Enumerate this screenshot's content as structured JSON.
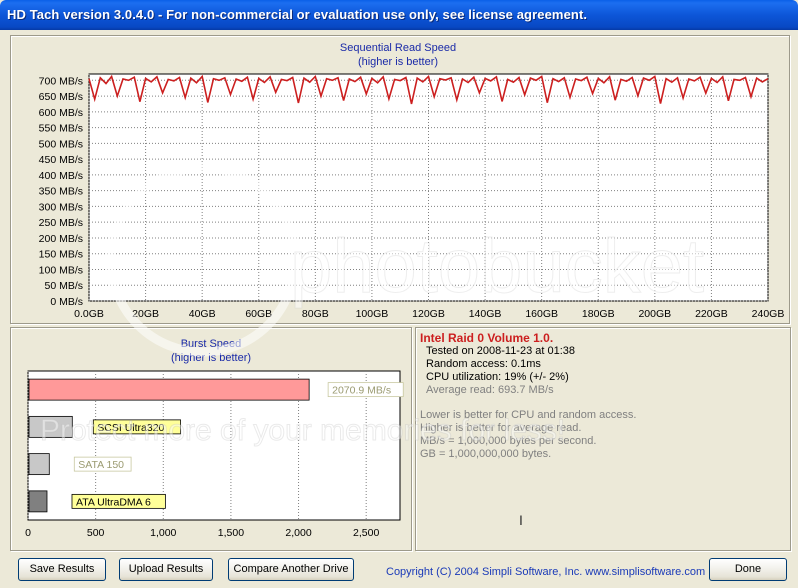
{
  "window": {
    "title": "HD Tach version 3.0.4.0  - For non-commercial or evaluation use only, see license agreement."
  },
  "chart_data": [
    {
      "type": "line",
      "title": "Sequential Read Speed",
      "subtitle": "(higher is better)",
      "x_ticks": [
        "0.0GB",
        "20GB",
        "40GB",
        "60GB",
        "80GB",
        "100GB",
        "120GB",
        "140GB",
        "160GB",
        "180GB",
        "200GB",
        "220GB",
        "240GB"
      ],
      "y_ticks": [
        "0 MB/s",
        "50 MB/s",
        "100 MB/s",
        "150 MB/s",
        "200 MB/s",
        "250 MB/s",
        "300 MB/s",
        "350 MB/s",
        "400 MB/s",
        "450 MB/s",
        "500 MB/s",
        "550 MB/s",
        "600 MB/s",
        "650 MB/s",
        "700 MB/s"
      ],
      "xlim": [
        0,
        240
      ],
      "ylim": [
        0,
        720
      ],
      "x_unit": "GB",
      "y_unit": "MB/s",
      "grid": true,
      "series": [
        {
          "color": "#cc1f1f",
          "x": [
            0,
            2,
            4,
            6,
            8,
            10,
            12,
            14,
            16,
            18,
            20,
            22,
            24,
            26,
            28,
            30,
            32,
            34,
            36,
            38,
            40,
            42,
            44,
            46,
            48,
            50,
            52,
            54,
            56,
            58,
            60,
            62,
            64,
            66,
            68,
            70,
            72,
            74,
            76,
            78,
            80,
            82,
            84,
            86,
            88,
            90,
            92,
            94,
            96,
            98,
            100,
            102,
            104,
            106,
            108,
            110,
            112,
            114,
            116,
            118,
            120,
            122,
            124,
            126,
            128,
            130,
            132,
            134,
            136,
            138,
            140,
            142,
            144,
            146,
            148,
            150,
            152,
            154,
            156,
            158,
            160,
            162,
            164,
            166,
            168,
            170,
            172,
            174,
            176,
            178,
            180,
            182,
            184,
            186,
            188,
            190,
            192,
            194,
            196,
            198,
            200,
            202,
            204,
            206,
            208,
            210,
            212,
            214,
            216,
            218,
            220,
            222,
            224,
            226,
            228,
            230,
            232,
            234,
            236,
            238,
            240
          ],
          "values": [
            705,
            640,
            708,
            690,
            712,
            650,
            704,
            700,
            710,
            632,
            706,
            695,
            711,
            660,
            703,
            698,
            709,
            645,
            707,
            692,
            712,
            630,
            705,
            700,
            708,
            655,
            704,
            697,
            710,
            640,
            706,
            693,
            711,
            662,
            703,
            699,
            709,
            628,
            707,
            694,
            712,
            650,
            705,
            700,
            708,
            636,
            704,
            696,
            710,
            657,
            706,
            692,
            711,
            641,
            703,
            699,
            709,
            625,
            707,
            695,
            712,
            648,
            705,
            701,
            708,
            638,
            704,
            693,
            710,
            660,
            706,
            698,
            711,
            633,
            703,
            694,
            709,
            654,
            707,
            700,
            712,
            629,
            705,
            696,
            708,
            646,
            704,
            699,
            710,
            658,
            706,
            692,
            711,
            637,
            703,
            697,
            709,
            651,
            707,
            700,
            712,
            626,
            705,
            694,
            708,
            644,
            704,
            698,
            710,
            659,
            706,
            693,
            711,
            635,
            703,
            700,
            709,
            648,
            707,
            695,
            705
          ]
        }
      ]
    },
    {
      "type": "bar",
      "orientation": "horizontal",
      "title": "Burst Speed",
      "subtitle": "(higher is better)",
      "x_ticks": [
        "0",
        "500",
        "1,000",
        "1,500",
        "2,000",
        "2,500"
      ],
      "xlim": [
        0,
        2750
      ],
      "grid": true,
      "bars": [
        {
          "value": 2070.9,
          "label": "2070.9 MB/s",
          "color": "#ff9999"
        },
        {
          "value": 320,
          "label": "SCSI Ultra320",
          "color": "#c8c8c8"
        },
        {
          "value": 150,
          "label": "SATA 150",
          "color": "#c8c8c8"
        },
        {
          "value": 133,
          "label": "ATA UltraDMA 6",
          "color": "#808080"
        }
      ]
    }
  ],
  "info": {
    "drive_name": "Intel Raid 0 Volume 1.0.",
    "tested_on": "Tested on 2008-11-23 at 01:38",
    "random_access": "Random access: 0.1ms",
    "cpu_utilization": "CPU utilization: 19% (+/- 2%)",
    "average_read": "Average read: 693.7 MB/s",
    "note1": "Lower is better for CPU and random access.",
    "note2": "Higher is better for average read.",
    "note3": "MB/s = 1,000,000 bytes per second.",
    "note4": "GB = 1,000,000,000 bytes."
  },
  "buttons": {
    "save": "Save Results",
    "upload": "Upload Results",
    "compare": "Compare Another Drive",
    "done": "Done"
  },
  "footer": {
    "copyright": "Copyright (C) 2004 Simpli Software, Inc. www.simplisoftware.com"
  },
  "colors": {
    "title_blue": "#1a2aa8",
    "drive_red": "#cc1f1f",
    "label_yellow": "#ffff99",
    "gray_text": "#808080"
  },
  "watermark": {
    "logo_text": "photobucket",
    "banner_text": "Protect more of your memories for less!"
  }
}
